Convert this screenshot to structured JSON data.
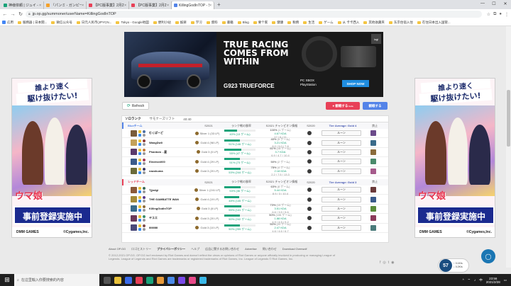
{
  "browser": {
    "tabs": [
      {
        "label": "神様依頼 | ジュイ - 不好ニお...",
        "color": "#1aa37a",
        "active": false
      },
      {
        "label": "『パンミ - ガンピームの...', 'color': ",
        "color": "#f4a12a",
        "active": false
      },
      {
        "label": "【PC版事業】2月27日 RNGバ...",
        "color": "#e84057",
        "active": false
      },
      {
        "label": "【PC版事業】2月27日 RNG...",
        "color": "#e84057",
        "active": false
      },
      {
        "label": "KillingGodInTOP - Summoner...",
        "color": "#5383e8",
        "active": true
      }
    ],
    "url": "jp.op.gg/summoner/userName=KillingGodInTOP",
    "bookmarks": [
      {
        "label": "応用",
        "type": "grid"
      },
      {
        "label": "服務器 | 日本関..."
      },
      {
        "label": "微信公众号"
      },
      {
        "label": "日元人民币(JPYCN..."
      },
      {
        "label": "Tokyo - Google地図"
      },
      {
        "label": "便利小站"
      },
      {
        "label": "娯楽"
      },
      {
        "label": "学习"
      },
      {
        "label": "資料"
      },
      {
        "label": "書籍"
      },
      {
        "label": "Blog"
      },
      {
        "label": "要个家"
      },
      {
        "label": "健康"
      },
      {
        "label": "税務"
      },
      {
        "label": "生活"
      },
      {
        "label": "ゲーム"
      },
      {
        "label": "从 卡卡西入"
      },
      {
        "label": "其他收藏夹"
      },
      {
        "label": "东京住宿入住"
      },
      {
        "label": "在住日本出入国管..."
      }
    ]
  },
  "top_ad": {
    "headline_1": "TRUE RACING",
    "headline_2": "COMES FROM",
    "headline_3": "WITHIN",
    "product": "G923 TRUEFORCE",
    "product_sub": "",
    "platform_1": "PC  XBOX",
    "platform_2": "PlayStation",
    "shop_label": "SHOP NOW",
    "brand": "logi"
  },
  "side_ad": {
    "line1": "誰より速く",
    "line2": "駆け抜けたい!",
    "logo": "ウマ娘",
    "banner": "事前登録実施中",
    "foot_left": "DMM GAMES",
    "foot_right": "©Cygames,Inc."
  },
  "toolbar": {
    "refresh_label": "Refresh",
    "spectate_label": "観戦する",
    "spectate_badge": "beta",
    "record_label": "観戦する"
  },
  "queue_tabs": [
    "ソロランク",
    "サモナーズリフト",
    "40:40"
  ],
  "columns": {
    "s2021": "S2021",
    "rank_winrate": "ランク戦の勝率",
    "champ_info": "S2021 チャンピオン情報",
    "s2020": "S2020",
    "ban": "禁止"
  },
  "blue_team": {
    "name": "Blueチーム",
    "avg_tier": "Tier Average: Gold 4",
    "players": [
      {
        "name": "むくぱーど",
        "tier": "Silver 1 (33 LP)",
        "winrate": 40,
        "wr_text": "40% (13 ゲーム)",
        "champ_wr": "100%",
        "champ_games": "(1 ゲーム)",
        "kda": "4.67 KDA",
        "kd": "17 / 6 / 11",
        "rune": "ルーン",
        "c1": "#7a5c3a",
        "c2": "#4a6fa5",
        "ban": "#6b4a8a"
      },
      {
        "name": "WangDw0",
        "tier": "Gold 4 (98 LP)",
        "winrate": 51,
        "wr_text": "51% (146 ゲーム)",
        "champ_wr": "40%",
        "champ_games": "(5 ゲーム)",
        "kda": "3.21 KDA",
        "kd": "8.0 / 5.0 / 7.8",
        "rune": "ルーン",
        "c1": "#c4a15a",
        "c2": "#8b3a3a",
        "ban": "#3a6b8a"
      },
      {
        "name": "Phantom→星",
        "tier": "Gold 3 (0 LP)",
        "winrate": 55,
        "wr_text": "55% (47 ゲーム)",
        "champ_wr": "61%",
        "champ_games": "(18 ゲーム)",
        "kda": "3.7 KDA",
        "kd": "6.9 / 4.7 / 10.4",
        "rune": "ルーン",
        "c1": "#5a3a6b",
        "c2": "#c47a3a",
        "ban": "#8a6b3a"
      },
      {
        "name": "Electron000",
        "tier": "Gold 4 (29 LP)",
        "winrate": 51,
        "wr_text": "51% (73 ゲーム)",
        "champ_wr": "50%",
        "champ_games": "(2 ゲーム)",
        "kda": "",
        "kd": "",
        "rune": "ルーン",
        "c1": "#3a5a8b",
        "c2": "#a53a5a",
        "ban": "#4a8a6b"
      },
      {
        "name": "nazokuma",
        "tier": "Gold 3 (20 LP)",
        "winrate": 53,
        "wr_text": "53% (244 ゲーム)",
        "champ_wr": "75%",
        "champ_games": "(4 ゲーム)",
        "kda": "2.18 KDA",
        "kd": "2.2 / 7.5 / 13.3",
        "rune": "ルーン",
        "c1": "#6b6b3a",
        "c2": "#3a3a6b",
        "ban": "#a55a8b"
      }
    ]
  },
  "red_team": {
    "name": "レッドチーム",
    "avg_tier": "Tier Average: Gold 3",
    "players": [
      {
        "name": "Tjjndgi",
        "tier": "Silver 1 (241 LP)",
        "winrate": 53,
        "wr_text": "53% (36 ゲーム)",
        "champ_wr": "63%",
        "champ_games": "(8 ゲーム)",
        "kda": "5.44 KDA",
        "kd": "8.9 / 3 / 10.4",
        "rune": "ルーン",
        "c1": "#8b5a3a",
        "c2": "#3a6b5a",
        "ban": "#6b3a3a"
      },
      {
        "name": "THE GAMBATTE WAN",
        "tier": "Gold 4 (19 LP)",
        "winrate": 48,
        "wr_text": "48% (145 ゲーム)",
        "champ_wr": "",
        "champ_games": "",
        "kda": "",
        "kd": "",
        "rune": "ルーン",
        "c1": "#a58b3a",
        "c2": "#5a3a8b",
        "ban": "#3a5a8b"
      },
      {
        "name": "KillingGodInTOP",
        "tier": "Gold 3 (8 LP)",
        "winrate": 55,
        "wr_text": "55% (141 ゲーム)",
        "champ_wr": "73%",
        "champ_games": "(15 ゲーム)",
        "kda": "3.51 KDA",
        "kd": "6.6 / 3.5 / 5.6",
        "rune": "ルーン",
        "c1": "#3a6b8b",
        "c2": "#8b6b3a",
        "ban": "#5a8b3a"
      },
      {
        "name": "ヤユエ",
        "tier": "Gold 3 (20 LP)",
        "winrate": 50,
        "wr_text": "50% (242 ゲーム)",
        "champ_wr": "50%",
        "champ_games": "(106 ゲーム)",
        "kda": "1.88 KDA",
        "kd": "4.9 / 4.5 / 5.2",
        "rune": "ルーン",
        "c1": "#6b3a5a",
        "c2": "#3a8b6b",
        "ban": "#8b3a5a"
      },
      {
        "name": "IIIIIIIIIII",
        "tier": "Gold 3 (10 LP)",
        "winrate": 50,
        "wr_text": "50% (259 ゲーム)",
        "champ_wr": "50%",
        "champ_games": "(20 ゲーム)",
        "kda": "2.47 KDA",
        "kd": "4.6 / 4.6 / 6.7",
        "rune": "ルーン",
        "c1": "#4a4a7a",
        "c2": "#7a4a4a",
        "ban": "#4a7a7a"
      }
    ]
  },
  "footer": {
    "links": [
      "About OP.GG",
      "ロゴヒストリー",
      "プライバシーポリシー",
      "ヘルプ",
      "広告に関するお問い合わせ",
      "Advertise",
      "問い合わせ",
      "Download Overwolf"
    ],
    "legal_1": "© 2012-2021 OP.GG. OP.GG isn't endorsed by Riot Games and doesn't reflect the views or opinions of Riot Games or anyone officially involved in producing or managing League of",
    "legal_2": "Legends. League of Legends and Riot Games are trademarks or registered trademarks of Riot Games, Inc. League of Legends © Riot Games, Inc."
  },
  "netmon": {
    "value": "57",
    "up": "↑ 0.1K/s",
    "down": "↓ 0.2K/s"
  },
  "taskbar": {
    "search_placeholder": "在這里輸入你要搜索的內容",
    "time": "23:56",
    "date": "2021/2/28",
    "lang": "中"
  }
}
